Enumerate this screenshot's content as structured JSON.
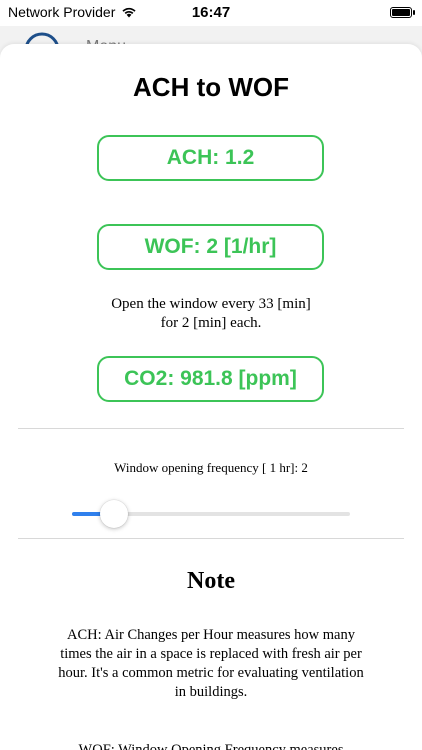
{
  "status_bar": {
    "carrier": "Network Provider",
    "time": "16:47",
    "wifi_icon": "wifi-icon",
    "battery_icon": "battery-icon"
  },
  "behind": {
    "title": "Menu"
  },
  "sheet": {
    "title": "ACH to WOF",
    "ach_label": "ACH: 1.2",
    "wof_label": "WOF: 2 [1/hr]",
    "hint_line1": "Open the window every 33 [min]",
    "hint_line2": "for 2 [min] each.",
    "co2_label": "CO2: 981.8 [ppm]",
    "slider_label": "Window opening frequency [ 1 hr]: 2",
    "slider": {
      "value": 2,
      "fraction": 0.11
    },
    "note_heading": "Note",
    "note_ach": "ACH: Air Changes per Hour measures how many times the air in a space is replaced with fresh air per hour. It's a common metric for evaluating ventilation in buildings.",
    "note_wof": "WOF: Window Opening Frequency measures"
  },
  "colors": {
    "accent_green": "#3cc457",
    "slider_blue": "#2f80ed"
  }
}
